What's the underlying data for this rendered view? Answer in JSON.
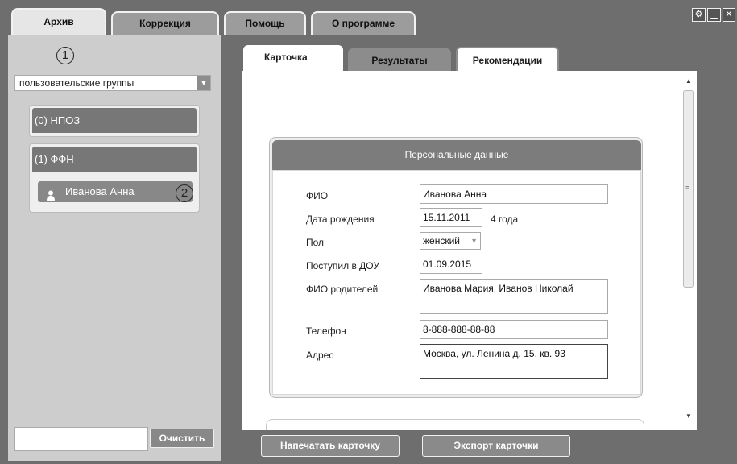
{
  "top_tabs": [
    {
      "label": "Архив",
      "active": true
    },
    {
      "label": "Коррекция",
      "active": false
    },
    {
      "label": "Помощь",
      "active": false
    },
    {
      "label": "О программе",
      "active": false
    }
  ],
  "window_controls": {
    "settings_icon": "gear-icon",
    "minimize_icon": "minimize-icon",
    "close_icon": "close-icon"
  },
  "annotations": {
    "marker_1": "1",
    "marker_2": "2"
  },
  "sidebar": {
    "group_select_value": "пользовательские группы",
    "groups": [
      {
        "title": "(0) НПОЗ",
        "members": []
      },
      {
        "title": "(1) ФФН",
        "members": [
          {
            "name": "Иванова Анна"
          }
        ]
      }
    ],
    "search_value": "",
    "clear_label": "Очистить"
  },
  "sub_tabs": [
    {
      "label": "Карточка",
      "active": true
    },
    {
      "label": "Результаты",
      "active": false
    },
    {
      "label": "Рекомендации",
      "active": false
    }
  ],
  "personal_data": {
    "header": "Персональные данные",
    "fio_label": "ФИО",
    "fio_value": "Иванова Анна",
    "birth_label": "Дата рождения",
    "birth_value": "15.11.2011",
    "age_text": "4 года",
    "gender_label": "Пол",
    "gender_value": "женский",
    "enrolled_label": "Поступил в ДОУ",
    "enrolled_value": "01.09.2015",
    "parents_label": "ФИО родителей",
    "parents_value": "Иванова Мария, Иванов Николай",
    "phone_label": "Телефон",
    "phone_value": "8-888-888-88-88",
    "address_label": "Адрес",
    "address_value": "Москва, ул. Ленина д. 15, кв. 93"
  },
  "actions": {
    "print_label": "Напечатать карточку",
    "export_label": "Экспорт карточки"
  },
  "colors": {
    "background": "#6e6e6e",
    "panel": "#cdcdcd",
    "header_gray": "#7c7c7c"
  }
}
